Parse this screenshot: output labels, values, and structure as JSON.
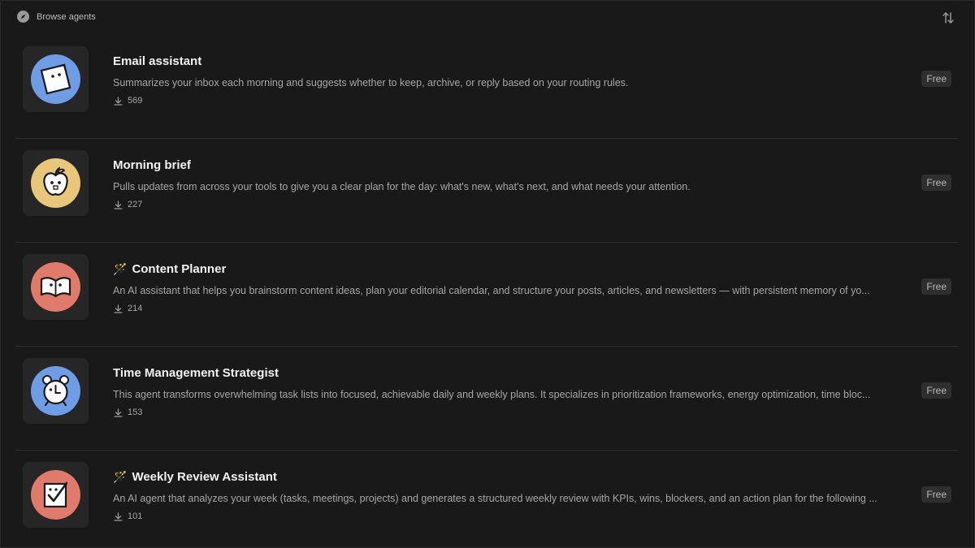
{
  "header": {
    "title": "Browse agents",
    "icons": {
      "browse": "compass-icon",
      "sort": "sort-icon"
    }
  },
  "agents": [
    {
      "title": "Email assistant",
      "emoji": "",
      "description": "Summarizes your inbox each morning and suggests whether to keep, archive, or reply based on your routing rules.",
      "downloads": "569",
      "price": "Free",
      "icon": "note-icon",
      "icon_color": "#6e9de6"
    },
    {
      "title": "Morning brief",
      "emoji": "",
      "description": "Pulls updates from across your tools to give you a clear plan for the day: what's new, what's next, and what needs your attention.",
      "downloads": "227",
      "price": "Free",
      "icon": "apple-icon",
      "icon_color": "#e8c77a"
    },
    {
      "title": "Content Planner",
      "emoji": "🪄",
      "description": "An AI assistant that helps you brainstorm content ideas, plan your editorial calendar, and structure your posts, articles, and newsletters — with persistent memory of yo...",
      "downloads": "214",
      "price": "Free",
      "icon": "book-icon",
      "icon_color": "#e07a6b"
    },
    {
      "title": "Time Management Strategist",
      "emoji": "",
      "description": "This agent transforms overwhelming task lists into focused, achievable daily and weekly plans. It specializes in prioritization frameworks, energy optimization, time bloc...",
      "downloads": "153",
      "price": "Free",
      "icon": "alarm-clock-icon",
      "icon_color": "#6e9de6"
    },
    {
      "title": "Weekly Review Assistant",
      "emoji": "🪄",
      "description": "An AI agent that analyzes your week (tasks, meetings, projects) and generates a structured weekly review with KPIs, wins, blockers, and an action plan for the following ...",
      "downloads": "101",
      "price": "Free",
      "icon": "checklist-icon",
      "icon_color": "#e07a6b"
    }
  ]
}
